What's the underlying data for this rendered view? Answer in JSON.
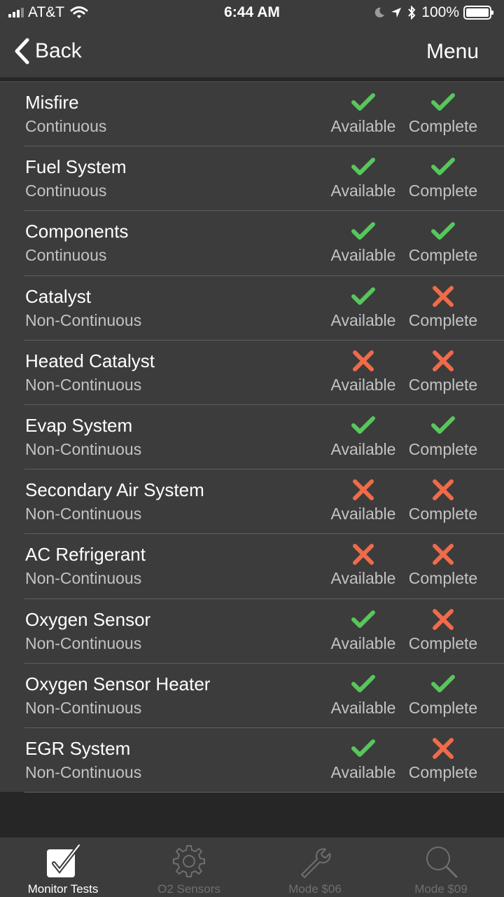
{
  "status_bar": {
    "carrier": "AT&T",
    "time": "6:44 AM",
    "battery": "100%"
  },
  "nav": {
    "back_label": "Back",
    "menu_label": "Menu"
  },
  "colors": {
    "check": "#58c65c",
    "cross": "#ef6b4a"
  },
  "monitors": [
    {
      "name": "Misfire",
      "type": "Continuous",
      "available": true,
      "complete": true
    },
    {
      "name": "Fuel System",
      "type": "Continuous",
      "available": true,
      "complete": true
    },
    {
      "name": "Components",
      "type": "Continuous",
      "available": true,
      "complete": true
    },
    {
      "name": "Catalyst",
      "type": "Non-Continuous",
      "available": true,
      "complete": false
    },
    {
      "name": "Heated Catalyst",
      "type": "Non-Continuous",
      "available": false,
      "complete": false
    },
    {
      "name": "Evap System",
      "type": "Non-Continuous",
      "available": true,
      "complete": true
    },
    {
      "name": "Secondary Air System",
      "type": "Non-Continuous",
      "available": false,
      "complete": false
    },
    {
      "name": "AC Refrigerant",
      "type": "Non-Continuous",
      "available": false,
      "complete": false
    },
    {
      "name": "Oxygen Sensor",
      "type": "Non-Continuous",
      "available": true,
      "complete": false
    },
    {
      "name": "Oxygen Sensor Heater",
      "type": "Non-Continuous",
      "available": true,
      "complete": true
    },
    {
      "name": "EGR System",
      "type": "Non-Continuous",
      "available": true,
      "complete": false
    }
  ],
  "labels": {
    "available": "Available",
    "complete": "Complete"
  },
  "tabs": [
    {
      "label": "Monitor Tests",
      "icon": "checkbox-icon",
      "active": true
    },
    {
      "label": "O2 Sensors",
      "icon": "gear-icon",
      "active": false
    },
    {
      "label": "Mode $06",
      "icon": "wrench-icon",
      "active": false
    },
    {
      "label": "Mode $09",
      "icon": "magnifier-icon",
      "active": false
    }
  ]
}
